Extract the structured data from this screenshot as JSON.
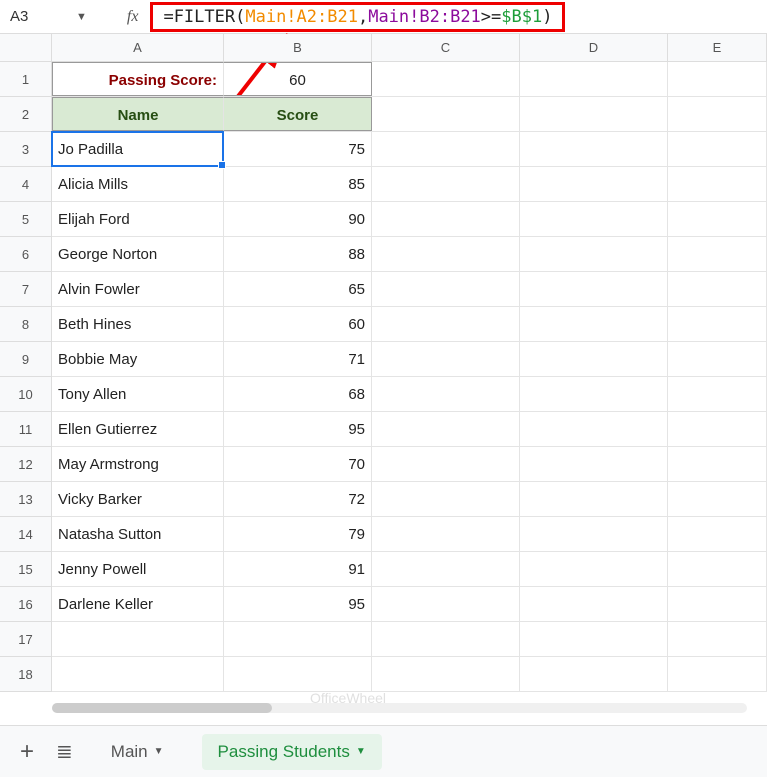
{
  "nameBox": "A3",
  "formula": {
    "fn": "FILTER",
    "range1": "Main!A2:B21",
    "range2": "Main!B2:B21",
    "op": ">=",
    "abs": "$B$1"
  },
  "columns": [
    "A",
    "B",
    "C",
    "D",
    "E"
  ],
  "rowNumbers": [
    1,
    2,
    3,
    4,
    5,
    6,
    7,
    8,
    9,
    10,
    11,
    12,
    13,
    14,
    15,
    16,
    17,
    18
  ],
  "passingLabel": "Passing Score:",
  "passingValue": "60",
  "headers": {
    "name": "Name",
    "score": "Score"
  },
  "data": [
    {
      "name": "Jo Padilla",
      "score": 75
    },
    {
      "name": "Alicia Mills",
      "score": 85
    },
    {
      "name": "Elijah Ford",
      "score": 90
    },
    {
      "name": "George Norton",
      "score": 88
    },
    {
      "name": "Alvin Fowler",
      "score": 65
    },
    {
      "name": "Beth Hines",
      "score": 60
    },
    {
      "name": "Bobbie May",
      "score": 71
    },
    {
      "name": "Tony Allen",
      "score": 68
    },
    {
      "name": "Ellen Gutierrez",
      "score": 95
    },
    {
      "name": "May Armstrong",
      "score": 70
    },
    {
      "name": "Vicky Barker",
      "score": 72
    },
    {
      "name": "Natasha Sutton",
      "score": 79
    },
    {
      "name": "Jenny Powell",
      "score": 91
    },
    {
      "name": "Darlene Keller",
      "score": 95
    }
  ],
  "sheets": {
    "inactive": "Main",
    "active": "Passing Students"
  },
  "watermark": "OfficeWheel",
  "chart_data": {
    "type": "table",
    "title": "Passing Students",
    "columns": [
      "Name",
      "Score"
    ],
    "rows": [
      [
        "Jo Padilla",
        75
      ],
      [
        "Alicia Mills",
        85
      ],
      [
        "Elijah Ford",
        90
      ],
      [
        "George Norton",
        88
      ],
      [
        "Alvin Fowler",
        65
      ],
      [
        "Beth Hines",
        60
      ],
      [
        "Bobbie May",
        71
      ],
      [
        "Tony Allen",
        68
      ],
      [
        "Ellen Gutierrez",
        95
      ],
      [
        "May Armstrong",
        70
      ],
      [
        "Vicky Barker",
        72
      ],
      [
        "Natasha Sutton",
        79
      ],
      [
        "Jenny Powell",
        91
      ],
      [
        "Darlene Keller",
        95
      ]
    ],
    "passing_score": 60
  }
}
